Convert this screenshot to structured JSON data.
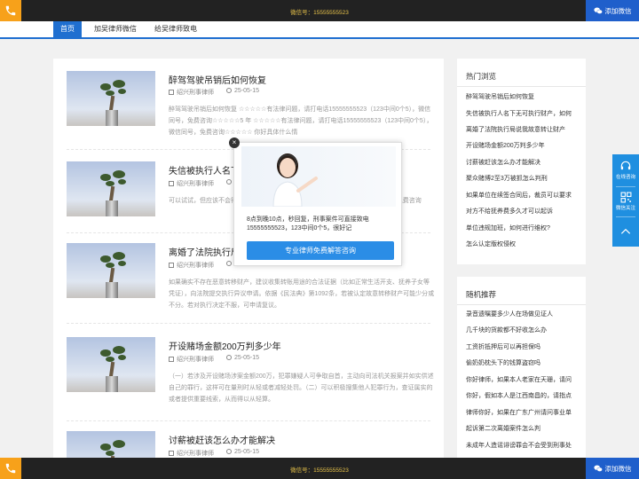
{
  "topbar": {
    "wechat": "微信号：15555555523",
    "add_wechat": "添加微信"
  },
  "bottombar": {
    "wechat": "微信号：15555555523",
    "add_wechat": "添加微信"
  },
  "nav": [
    "首页",
    "加吴律师微信",
    "给吴律师致电"
  ],
  "articles": [
    {
      "title": "醉驾驾驶吊销后如何恢复",
      "author": "绍兴刑事律师",
      "date": "25-05-15",
      "desc": "醉驾驾驶吊销后如何恢复 ☆☆☆☆☆有法律问题，请打电话15555555523（123中间0个5），微信同号，免费咨询☆☆☆☆☆5 年 ☆☆☆☆☆有法律问题，请打电话15555555523（123中间0个5），微信同号，免费咨询☆☆☆☆☆ 你好具体什么情"
    },
    {
      "title": "失信被执行人名下无",
      "author": "绍兴刑事律师",
      "date": "25",
      "desc": "可以试试，但应该不会得到 ）请打电话15555555523（123中间0个5），微信同号，免费咨询"
    },
    {
      "title": "离婚了法院执行局说",
      "author": "绍兴刑事律师",
      "date": "25",
      "desc": "如果确实不存在恶意转移财产，建议收集转账用途的合法证据（比如正常生活开支、抚养子女等凭证），向法院提交执行异议申请。依据《民法典》第1092条，若被认定故意转移财产可能少分或不分。若对执行决定不服，可申请复议。"
    },
    {
      "title": "开设赌场金额200万判多少年",
      "author": "绍兴刑事律师",
      "date": "25-05-15",
      "desc": "（一）若涉及开设赌场涉案金额200万，犯罪嫌疑人可争取自首，主动向司法机关报案并如实供述自己的罪行，这样可在量刑时从轻或者减轻处罚。（二）可以积极搜集他人犯罪行为，查证属实的或者提供重要线索，从而得以从轻算。"
    },
    {
      "title": "讨薪被赶该怎么办才能解决",
      "author": "绍兴刑事律师",
      "date": "25-05-15",
      "desc": ""
    }
  ],
  "sidebar_hot": {
    "title": "热门浏览",
    "items": [
      "醉驾驾驶吊销后如何恢复",
      "失信被执行人名下无可执行财产，如何",
      "离婚了法院执行局说我故意转让财产",
      "开设赌场金额200万判多少年",
      "讨薪被赶该怎么办才能解决",
      "聚众赌博2至3万被抓怎么判刑",
      "如果单位在续签合同后，裁员可以要求",
      "对方不给抚养费多久才可以起诉",
      "单位违规加班，如何进行维权?",
      "怎么认定版权侵权"
    ]
  },
  "sidebar_random": {
    "title": "随机推荐",
    "items": [
      "录音遗嘱要多少人在场做见证人",
      "几千块的货款都不好收怎么办",
      "工资折抵押后可以再担保吗",
      "偷奶奶枕头下的钱算盗窃吗",
      "你好律师，如果本人老家在天珊，请问",
      "你好，假如本人是江西南昌的，请指点",
      "律师你好，如果在广东广州请问事业单",
      "起诉第二次离婚案件怎么判",
      "未成年人造谣诽谤罪会不会受到刑事处"
    ]
  },
  "float": {
    "consult": "在线咨询",
    "follow": "微信关注"
  },
  "popup": {
    "close": "×",
    "text": "8点到晚10点，秒回复，刑事案件可直接致电15555555523，123中间0个5，很好记",
    "button": "专业律师免费解答咨询"
  },
  "icons": {
    "phone": "phone-icon",
    "wechat": "wechat-icon",
    "headset": "headset-icon",
    "qr": "qr-icon",
    "up": "chevron-up-icon"
  },
  "colors": {
    "accent": "#1f6fd0",
    "orange": "#f7a11a",
    "dark": "#222222",
    "float": "#1f8fe0"
  }
}
